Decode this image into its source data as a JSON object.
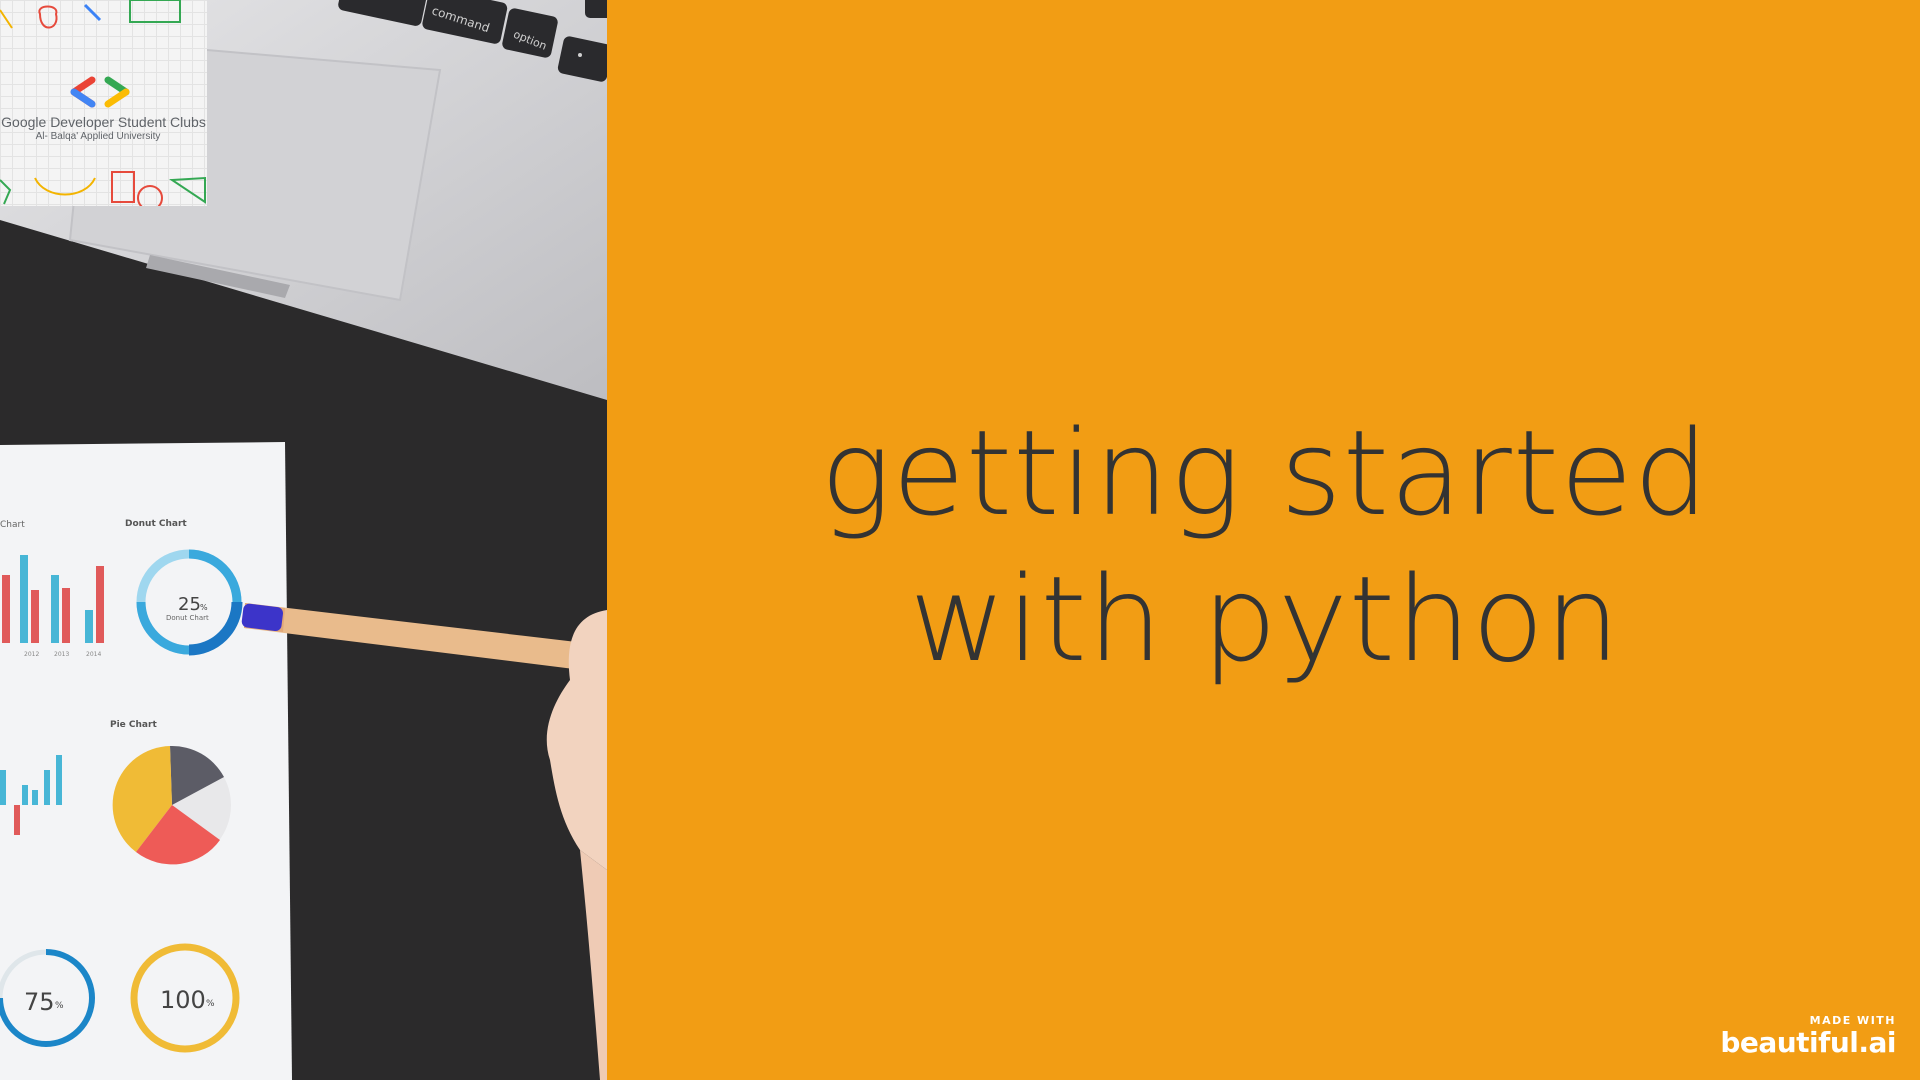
{
  "slide": {
    "title_line1": "getting started",
    "title_line2": "with python",
    "background_color": "#F29D14",
    "title_color": "#333333"
  },
  "logo": {
    "name": "Google Developer Student Clubs",
    "subtitle": "Al- Balqa' Applied University",
    "colors": [
      "#EA4335",
      "#4285F4",
      "#34A853",
      "#FBBC04"
    ]
  },
  "photo": {
    "keys": [
      "command",
      "option"
    ],
    "donut_title": "Donut Chart",
    "donut_value": "25",
    "pie_title": "Pie Chart",
    "gauge_1": "75",
    "gauge_2": "100",
    "unit": "%",
    "bar_title_fragment": "Chart",
    "years": [
      "2012",
      "2013",
      "2014"
    ]
  },
  "branding": {
    "made_with": "MADE WITH",
    "name": "beautiful.ai"
  }
}
